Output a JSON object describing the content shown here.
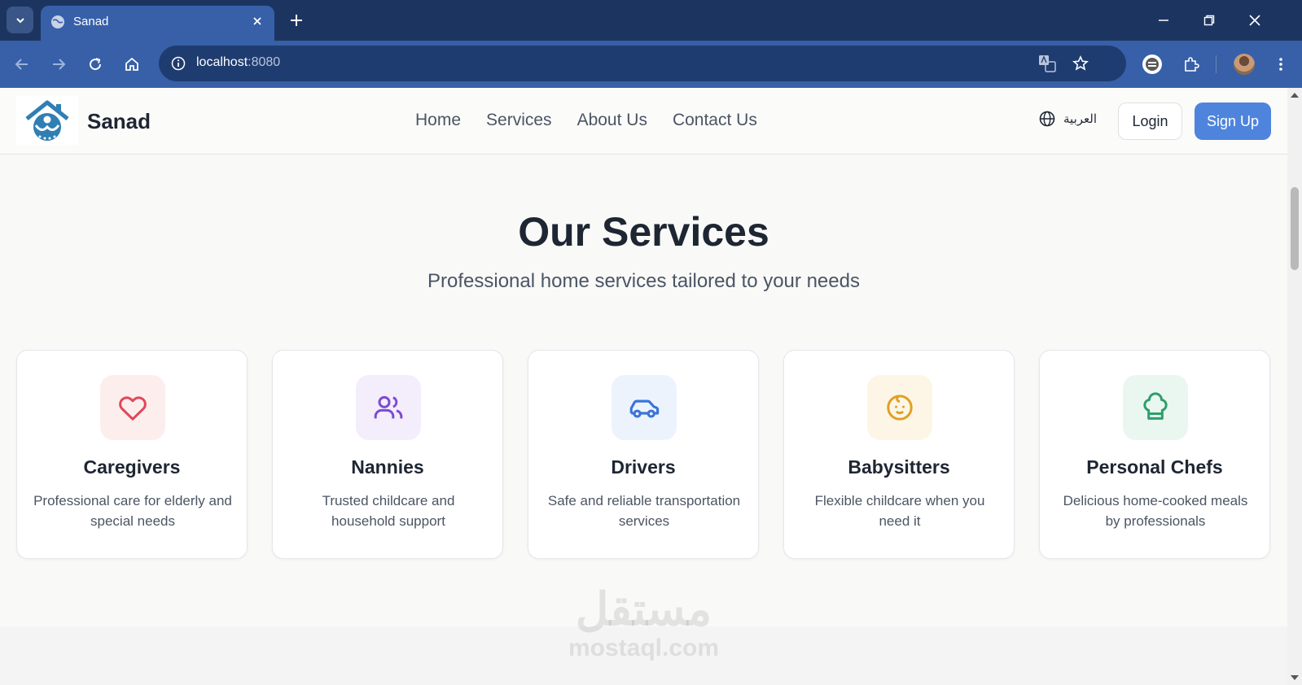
{
  "browser": {
    "tab_title": "Sanad",
    "url_host": "localhost",
    "url_port": ":8080"
  },
  "site": {
    "brand": "Sanad",
    "nav": [
      "Home",
      "Services",
      "About Us",
      "Contact Us"
    ],
    "language_label": "العربية",
    "login_label": "Login",
    "signup_label": "Sign Up",
    "accent_color": "#4f84dd"
  },
  "hero": {
    "title": "Our Services",
    "subtitle": "Professional home services tailored to your needs"
  },
  "services": [
    {
      "title": "Caregivers",
      "desc": "Professional care for elderly and special needs",
      "icon": "heart-icon",
      "color": "#e0475a",
      "bg": "#fdeeee"
    },
    {
      "title": "Nannies",
      "desc": "Trusted childcare and household support",
      "icon": "users-icon",
      "color": "#7c4bd0",
      "bg": "#f3edfc"
    },
    {
      "title": "Drivers",
      "desc": "Safe and reliable transportation services",
      "icon": "car-icon",
      "color": "#3b74d8",
      "bg": "#edf3fd"
    },
    {
      "title": "Babysitters",
      "desc": "Flexible childcare when you need it",
      "icon": "baby-icon",
      "color": "#e0a024",
      "bg": "#fdf6e6"
    },
    {
      "title": "Personal Chefs",
      "desc": "Delicious home-cooked meals by professionals",
      "icon": "chef-hat-icon",
      "color": "#2f9e6b",
      "bg": "#eaf7f0"
    }
  ],
  "watermark": {
    "arabic": "مستقل",
    "latin": "mostaql.com"
  }
}
